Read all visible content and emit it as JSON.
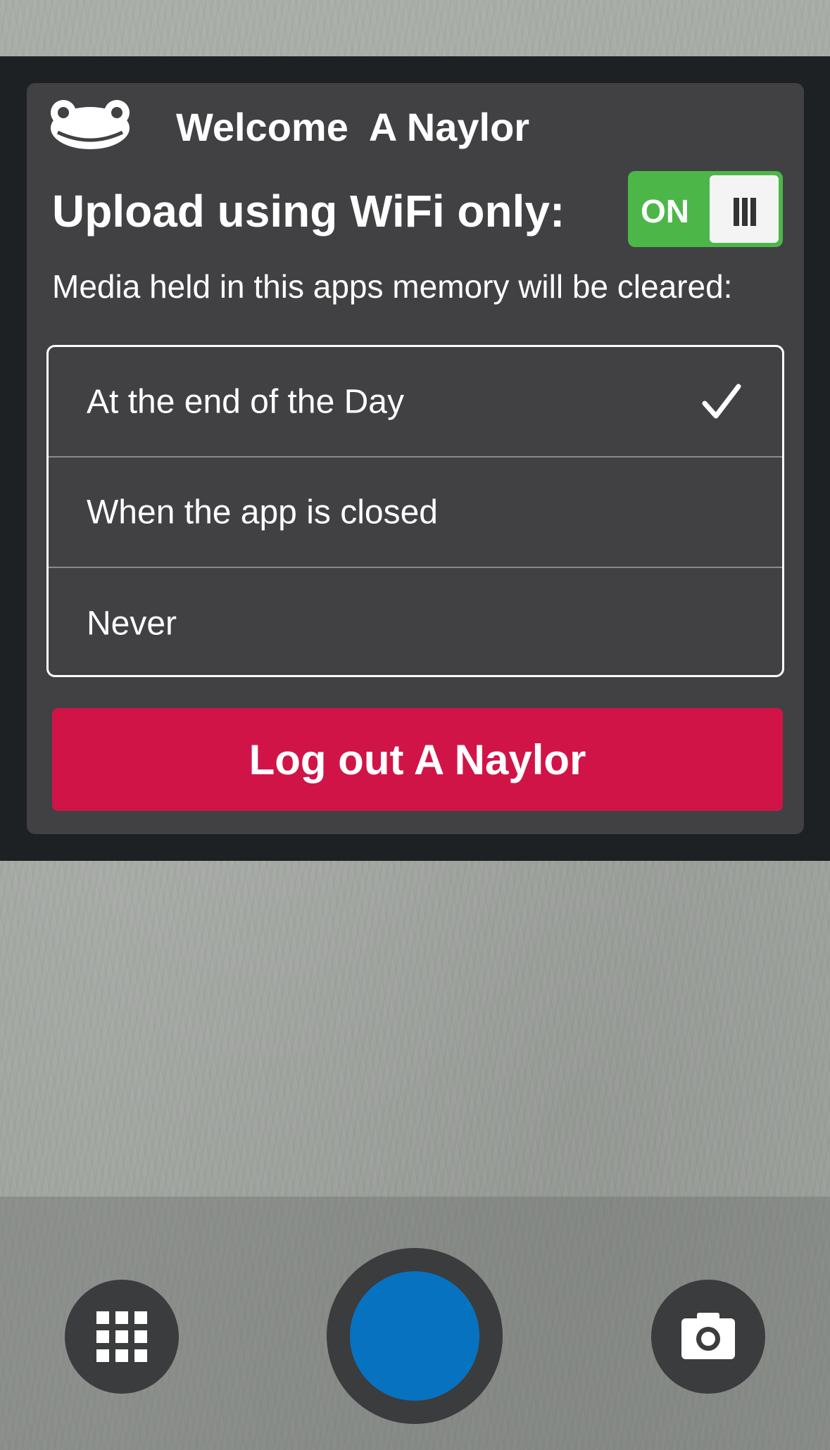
{
  "header": {
    "welcome_text": "Welcome  A Naylor",
    "logo_icon": "frog-logo-icon"
  },
  "wifi": {
    "label": "Upload using WiFi only:",
    "toggle_state_label": "ON",
    "toggle_on": true,
    "toggle_color": "#4cb748"
  },
  "media": {
    "label": "Media held in this apps memory will be cleared:",
    "options": [
      {
        "label": "At the end of the Day",
        "selected": true
      },
      {
        "label": "When the app is closed",
        "selected": false
      },
      {
        "label": "Never",
        "selected": false
      }
    ]
  },
  "logout": {
    "label": "Log out A Naylor",
    "color": "#d11447"
  },
  "bottom_bar": {
    "left_icon": "grid-icon",
    "center_icon": "shutter-button",
    "right_icon": "camera-icon",
    "shutter_color": "#0773c0"
  }
}
